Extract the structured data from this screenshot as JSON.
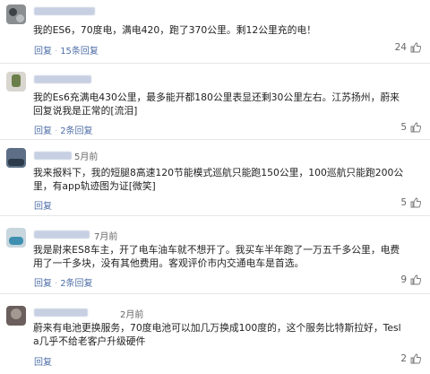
{
  "comments": [
    {
      "time": "",
      "text": "我的ES6，70度电，满电420，跑了370公里。剩12公里充的电！",
      "reply": "回复",
      "more_replies": "15条回复",
      "likes": "24"
    },
    {
      "time": "",
      "text": "我的Es6充满电430公里，最多能开都180公里表显还剩30公里左右。江苏扬州，蔚来回复说我是正常的[流泪]",
      "reply": "回复",
      "more_replies": "2条回复",
      "likes": "5"
    },
    {
      "time": "5月前",
      "text": "我来报料下，我的短腿8高速120节能模式巡航只能跑150公里，100巡航只能跑200公里，有app轨迹图为证[微笑]",
      "reply": "回复",
      "more_replies": "",
      "likes": "5"
    },
    {
      "time": "7月前",
      "text": "我是尉来ES8车主，开了电车油车就不想开了。我买车半年跑了一万五千多公里，电费用了一千多块，没有其他费用。客观评价市内交通电车是首选。",
      "reply": "回复",
      "more_replies": "2条回复",
      "likes": "9"
    },
    {
      "time": "2月前",
      "text": "蔚来有电池更换服务，70度电池可以加几万换成100度的，这个服务比特斯拉好，Tesla几乎不给老客户升级硬件",
      "reply": "回复",
      "more_replies": "",
      "likes": "2"
    }
  ]
}
